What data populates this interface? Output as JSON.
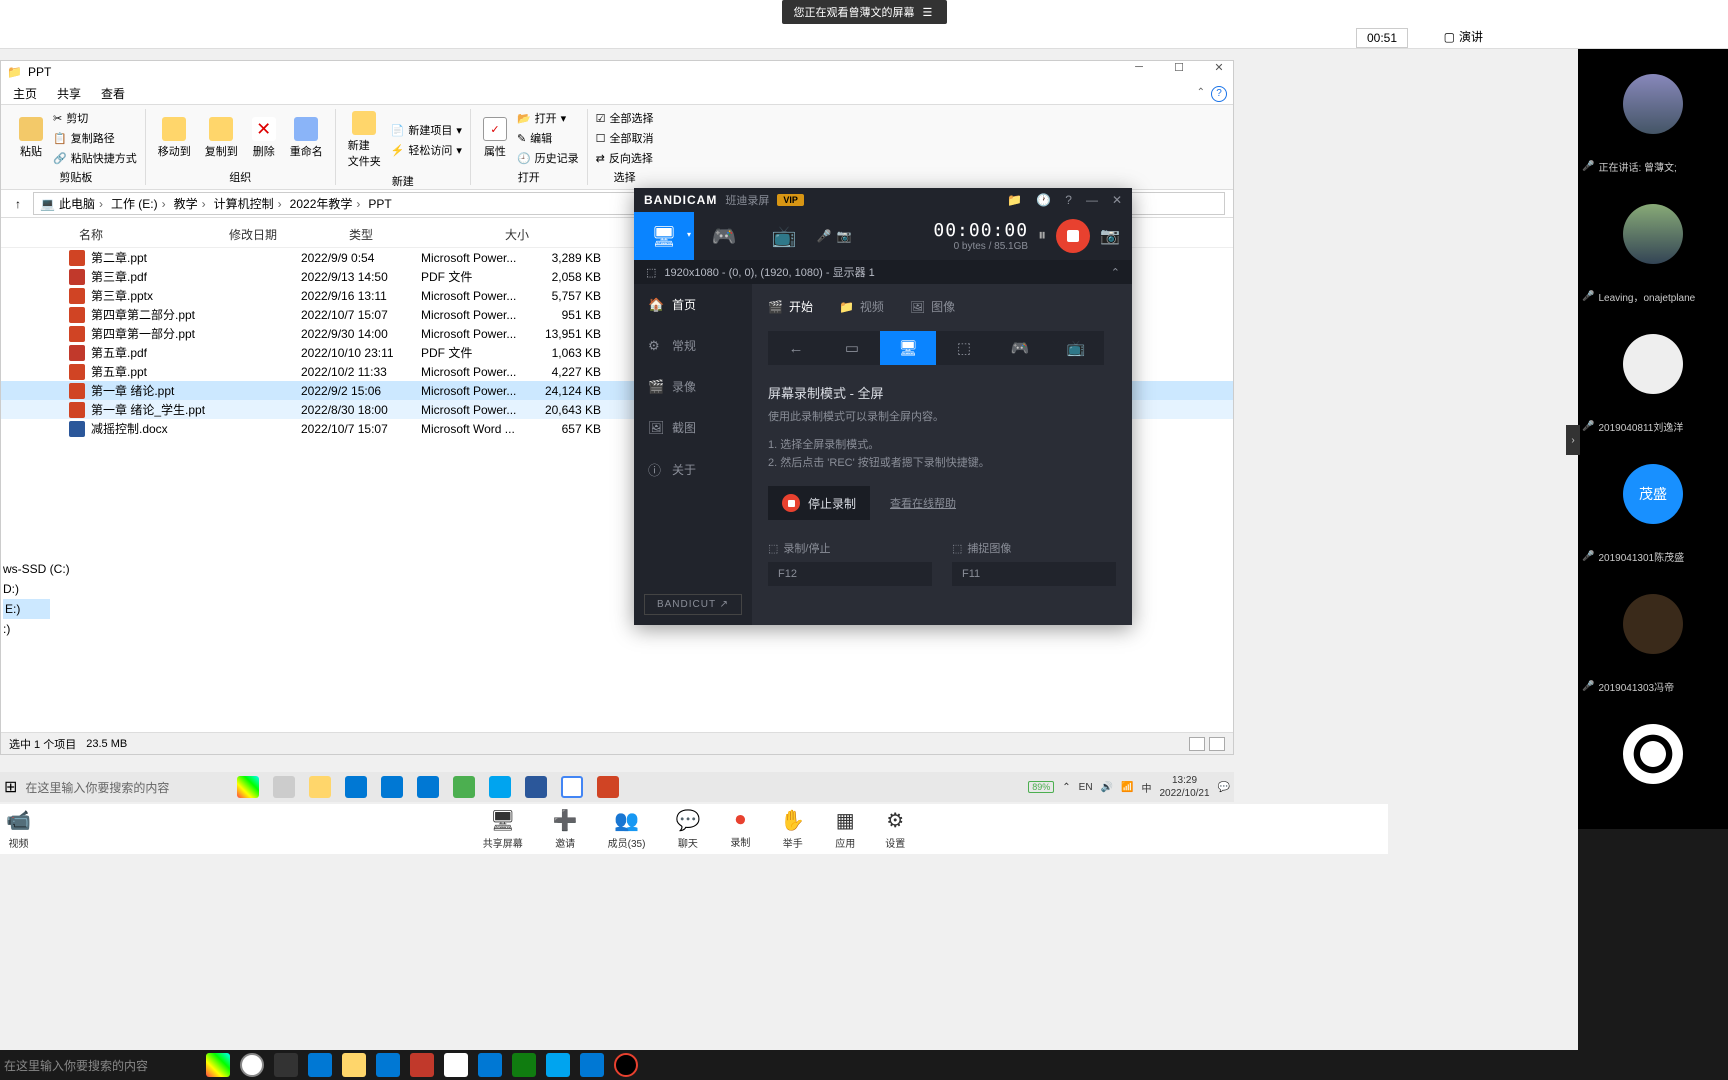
{
  "topbar": {
    "sharing_text": "您正在观看曾薄文的屏幕"
  },
  "meeting": {
    "timer": "00:51",
    "present": "演讲",
    "speaking": "正在讲话: 曾薄文;"
  },
  "explorer": {
    "title": "PPT",
    "tabs": [
      "主页",
      "共享",
      "查看"
    ],
    "ribbon": {
      "clipboard": {
        "label": "剪贴板",
        "paste": "粘贴",
        "cut": "剪切",
        "copy_path": "复制路径",
        "paste_shortcut": "粘贴快捷方式"
      },
      "organize": {
        "label": "组织",
        "move": "移动到",
        "copy": "复制到",
        "delete": "删除",
        "rename": "重命名"
      },
      "new": {
        "label": "新建",
        "folder": "新建\n文件夹",
        "item": "新建项目",
        "easy": "轻松访问"
      },
      "open": {
        "label": "打开",
        "props": "属性",
        "open": "打开",
        "edit": "编辑",
        "history": "历史记录"
      },
      "select": {
        "label": "选择",
        "all": "全部选择",
        "none": "全部取消",
        "invert": "反向选择"
      }
    },
    "breadcrumb": [
      "此电脑",
      "工作 (E:)",
      "教学",
      "计算机控制",
      "2022年教学",
      "PPT"
    ],
    "columns": {
      "name": "名称",
      "date": "修改日期",
      "type": "类型",
      "size": "大小"
    },
    "files": [
      {
        "name": "第二章.ppt",
        "date": "2022/9/9 0:54",
        "type": "Microsoft Power...",
        "size": "3,289 KB",
        "icon": "ppt"
      },
      {
        "name": "第三章.pdf",
        "date": "2022/9/13 14:50",
        "type": "PDF 文件",
        "size": "2,058 KB",
        "icon": "pdf"
      },
      {
        "name": "第三章.pptx",
        "date": "2022/9/16 13:11",
        "type": "Microsoft Power...",
        "size": "5,757 KB",
        "icon": "ppt"
      },
      {
        "name": "第四章第二部分.ppt",
        "date": "2022/10/7 15:07",
        "type": "Microsoft Power...",
        "size": "951 KB",
        "icon": "ppt"
      },
      {
        "name": "第四章第一部分.ppt",
        "date": "2022/9/30 14:00",
        "type": "Microsoft Power...",
        "size": "13,951 KB",
        "icon": "ppt"
      },
      {
        "name": "第五章.pdf",
        "date": "2022/10/10 23:11",
        "type": "PDF 文件",
        "size": "1,063 KB",
        "icon": "pdf"
      },
      {
        "name": "第五章.ppt",
        "date": "2022/10/2 11:33",
        "type": "Microsoft Power...",
        "size": "4,227 KB",
        "icon": "ppt"
      },
      {
        "name": "第一章 绪论.ppt",
        "date": "2022/9/2 15:06",
        "type": "Microsoft Power...",
        "size": "24,124 KB",
        "icon": "ppt",
        "selected": true
      },
      {
        "name": "第一章 绪论_学生.ppt",
        "date": "2022/8/30 18:00",
        "type": "Microsoft Power...",
        "size": "20,643 KB",
        "icon": "ppt",
        "hover": true
      },
      {
        "name": "减摇控制.docx",
        "date": "2022/10/7 15:07",
        "type": "Microsoft Word ...",
        "size": "657 KB",
        "icon": "docx"
      }
    ],
    "tree": {
      "ssd": "ws-SSD (C:)",
      "d": "D:)",
      "e": "E:)",
      "f": ":)"
    },
    "status": {
      "selected": "选中 1 个项目",
      "size": "23.5 MB"
    }
  },
  "bandicam": {
    "title": "BANDICAM",
    "subtitle": "班迪录屏",
    "vip": "VIP",
    "timer": "00:00:00",
    "bytes": "0 bytes / 85.1GB",
    "target": "1920x1080 - (0, 0), (1920, 1080) - 显示器 1",
    "side": {
      "home": "首页",
      "general": "常规",
      "video": "录像",
      "image": "截图",
      "about": "关于"
    },
    "bandicut": "BANDICUT ↗",
    "tabs": {
      "start": "开始",
      "video": "视频",
      "image": "图像"
    },
    "mode": {
      "title": "屏幕录制模式 - 全屏",
      "desc": "使用此录制模式可以录制全屏内容。"
    },
    "steps": {
      "s1": "1. 选择全屏录制模式。",
      "s2": "2. 然后点击 'REC' 按钮或者摁下录制快捷键。"
    },
    "stop": "停止录制",
    "help": "查看在线帮助",
    "hk": {
      "rec": "录制/停止",
      "rec_key": "F12",
      "cap": "捕捉图像",
      "cap_key": "F11"
    }
  },
  "participants": [
    {
      "name": "正在讲话: 曾薄文;",
      "bg": "landscape"
    },
    {
      "name": "Leaving，onajetplane",
      "bg": "landscape"
    },
    {
      "name": "2019040811刘逸洋",
      "bg": "none"
    },
    {
      "name": "2019041301陈茂盛",
      "bg": "blue",
      "initials": "茂盛"
    },
    {
      "name": "2019041303冯帝",
      "bg": "dark"
    },
    {
      "name": "",
      "bg": "panda"
    }
  ],
  "meeting_controls": {
    "left": "视频",
    "items": [
      {
        "label": "共享屏幕",
        "name": "share-screen"
      },
      {
        "label": "邀请",
        "name": "invite"
      },
      {
        "label": "成员(35)",
        "name": "members"
      },
      {
        "label": "聊天",
        "name": "chat"
      },
      {
        "label": "录制",
        "name": "record"
      },
      {
        "label": "举手",
        "name": "raise-hand"
      },
      {
        "label": "应用",
        "name": "apps"
      },
      {
        "label": "设置",
        "name": "settings"
      }
    ]
  },
  "taskbar1": {
    "search": "在这里输入你要搜索的内容",
    "battery": "89%",
    "lang": "EN",
    "ime": "中",
    "time": "13:29",
    "date": "2022/10/21"
  },
  "taskbar2": {
    "search": "在这里输入你要搜索的内容"
  }
}
